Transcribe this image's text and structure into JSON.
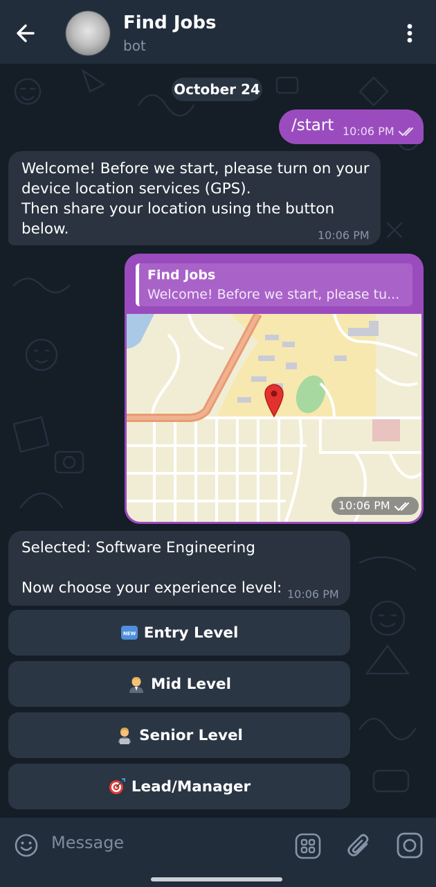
{
  "header": {
    "title": "Find Jobs",
    "subtitle": "bot"
  },
  "chat": {
    "date": "October 24",
    "messages": {
      "start": {
        "text": "/start",
        "time": "10:06 PM"
      },
      "welcome": {
        "text": "Welcome! Before we start, please turn on your\ndevice location services (GPS).\nThen share your location using the button\nbelow.",
        "time": "10:06 PM"
      },
      "location": {
        "reply_name": "Find Jobs",
        "reply_text": "Welcome! Before we start, please tu...",
        "time": "10:06 PM"
      },
      "selected": {
        "text": "Selected: Software Engineering\n\nNow choose your experience level:",
        "time": "10:06 PM"
      }
    },
    "keyboard": [
      {
        "label": "Entry Level",
        "icon": "new-badge-icon"
      },
      {
        "label": "Mid Level",
        "icon": "office-worker-icon"
      },
      {
        "label": "Senior Level",
        "icon": "technologist-icon"
      },
      {
        "label": "Lead/Manager",
        "icon": "dart-target-icon"
      }
    ]
  },
  "input": {
    "placeholder": "Message"
  },
  "colors": {
    "header_bg": "#212d3b",
    "chat_bg": "#151d26",
    "outgoing_bubble": "#9a4cbe",
    "incoming_bubble": "#2a333f",
    "keyboard_button": "#2b3644"
  }
}
